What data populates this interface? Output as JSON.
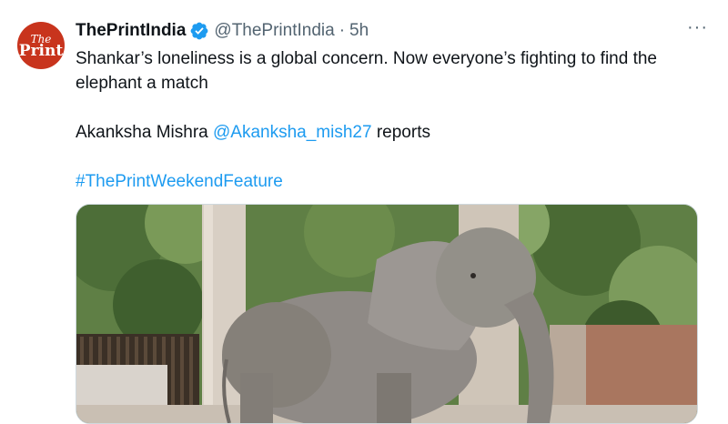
{
  "tweet": {
    "author_name": "ThePrintIndia",
    "handle": "@ThePrintIndia",
    "separator": "·",
    "time": "5h",
    "more": "···",
    "avatar": {
      "top": "The",
      "bottom": "Print",
      "color": "#c8341d"
    },
    "line1": "Shankar’s loneliness is a global concern. Now everyone’s fighting to find the elephant a match",
    "reporter_name": "Akanksha Mishra",
    "reporter_handle": "@Akanksha_mish27",
    "reporter_suffix": "reports",
    "hashtag": "#ThePrintWeekendFeature",
    "link_color": "#1d9bf0",
    "verified_icon": "verified-badge-icon",
    "image": "photo of elephant in zoo enclosure"
  }
}
